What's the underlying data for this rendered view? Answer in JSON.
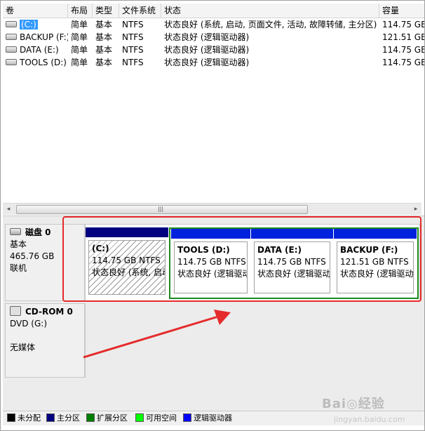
{
  "volumes": {
    "headers": [
      "卷",
      "布局",
      "类型",
      "文件系统",
      "状态",
      "容量"
    ],
    "rows": [
      {
        "name": "(C:)",
        "layout": "简单",
        "type": "基本",
        "fs": "NTFS",
        "status": "状态良好 (系统, 启动, 页面文件, 活动, 故障转储, 主分区)",
        "capacity": "114.75 GB",
        "selected": true
      },
      {
        "name": "BACKUP (F:)",
        "layout": "简单",
        "type": "基本",
        "fs": "NTFS",
        "status": "状态良好 (逻辑驱动器)",
        "capacity": "121.51 GB"
      },
      {
        "name": "DATA (E:)",
        "layout": "简单",
        "type": "基本",
        "fs": "NTFS",
        "status": "状态良好 (逻辑驱动器)",
        "capacity": "114.75 GB"
      },
      {
        "name": "TOOLS (D:)",
        "layout": "简单",
        "type": "基本",
        "fs": "NTFS",
        "status": "状态良好 (逻辑驱动器)",
        "capacity": "114.75 GB"
      }
    ]
  },
  "scrollbar": {
    "left_arrow": "◂",
    "right_arrow": "▸",
    "grip": "|||"
  },
  "disk0": {
    "title": "磁盘 0",
    "type": "基本",
    "size": "465.76 GB",
    "state": "联机",
    "partitions": [
      {
        "name": "(C:)",
        "size": "114.75 GB NTFS",
        "status": "状态良好 (系统, 启动",
        "kind": "primary"
      },
      {
        "name": "TOOLS  (D:)",
        "size": "114.75 GB NTFS",
        "status": "状态良好 (逻辑驱动",
        "kind": "logical"
      },
      {
        "name": "DATA  (E:)",
        "size": "114.75 GB NTFS",
        "status": "状态良好 (逻辑驱动",
        "kind": "logical"
      },
      {
        "name": "BACKUP  (F:)",
        "size": "121.51 GB NTFS",
        "status": "状态良好 (逻辑驱动",
        "kind": "logical"
      }
    ]
  },
  "cdrom": {
    "title": "CD-ROM 0",
    "type": "DVD (G:)",
    "media": "无媒体"
  },
  "legend": [
    {
      "label": "未分配",
      "color": "#000000"
    },
    {
      "label": "主分区",
      "color": "#000080"
    },
    {
      "label": "扩展分区",
      "color": "#008000"
    },
    {
      "label": "可用空间",
      "color": "#00ff00"
    },
    {
      "label": "逻辑驱动器",
      "color": "#0000ff"
    }
  ],
  "colors": {
    "primary_bar": "#000080",
    "logical_bar": "#0022dd",
    "extended_frame": "#1c8a1c",
    "annotation_red": "#e52b2b"
  },
  "watermark": {
    "text": "Bai◎经验",
    "sub": "jingyan.baidu.com"
  }
}
